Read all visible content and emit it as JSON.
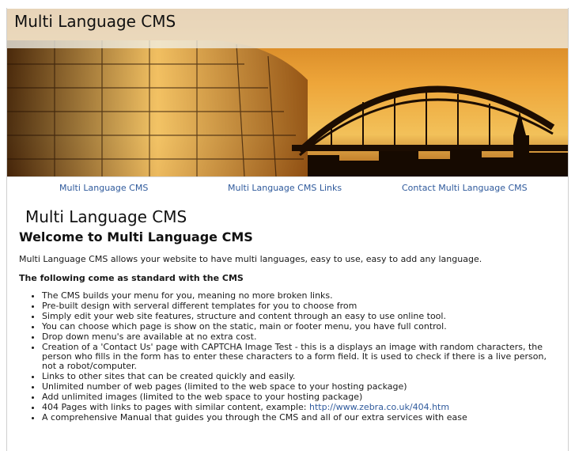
{
  "header": {
    "site_title": "Multi Language CMS",
    "banner_alt": "Sunset cityscape with arch bridge and glass building"
  },
  "nav": {
    "items": [
      {
        "label": "Multi Language CMS"
      },
      {
        "label": "Multi Language CMS Links"
      },
      {
        "label": "Contact Multi Language CMS"
      }
    ]
  },
  "main": {
    "heading": "Multi Language CMS",
    "welcome": "Welcome to Multi Language CMS",
    "intro": "Multi Language CMS allows your website to have multi languages, easy to use, easy to add any language.",
    "standard_heading": "The following come as standard with the CMS",
    "features": [
      "The CMS builds your menu for you, meaning no more broken links.",
      "Pre-built design with serveral different templates for you to choose from",
      "Simply edit your web site features, structure and content through an easy to use online tool.",
      "You can choose which page is show on the static, main or footer menu, you have full control.",
      "Drop down menu's are available at no extra cost.",
      "Creation of a 'Contact Us' page with CAPTCHA Image Test -  this is a displays an image with random characters, the person who fills in the form has to enter these characters to a form field. It is used to check if there is a live person, not a robot/computer.",
      "Links to other sites that can be created quickly and easily.",
      "Unlimited number of web pages (limited to the web space to your hosting package)",
      "Add unlimited images (limited to the web space to your hosting package)",
      "A comprehensive Manual that guides you through the CMS and all of our extra services with ease"
    ],
    "feature_404_text": "404 Pages with links to pages with similar content, example: ",
    "feature_404_link": "http://www.zebra.co.uk/404.htm"
  },
  "colors": {
    "link": "#2f5a9c",
    "banner_sky": "#e08a1c"
  }
}
